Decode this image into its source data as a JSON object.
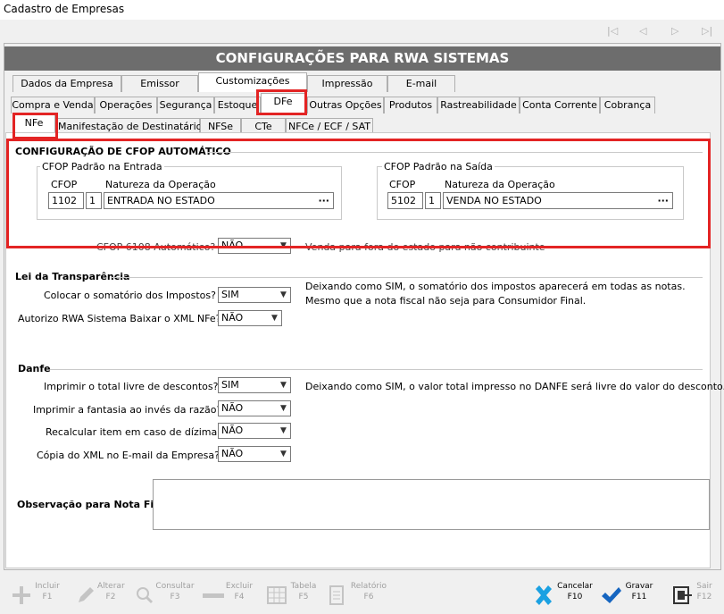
{
  "window": {
    "title": "Cadastro de Empresas"
  },
  "header": {
    "title": "CONFIGURAÇÕES PARA RWA SISTEMAS"
  },
  "tabs_row1": [
    "Dados da Empresa",
    "Emissor",
    "Customizações",
    "Impressão",
    "E-mail"
  ],
  "tabs_row2": [
    "Compra e Venda",
    "Operações",
    "Segurança",
    "Estoque",
    "DFe",
    "Outras Opções",
    "Produtos",
    "Rastreabilidade",
    "Conta Corrente",
    "Cobrança"
  ],
  "tabs_row3": [
    "NFe",
    "Manifestação de Destinatário",
    "NFSe",
    "CTe",
    "NFCe / ECF / SAT"
  ],
  "cfop": {
    "section_title": "CONFIGURAÇÃO DE CFOP AUTOMÁTICO",
    "entrada": {
      "group_label": "CFOP Padrão na Entrada",
      "cfop_label": "CFOP",
      "natureza_label": "Natureza da Operação",
      "cfop_value": "1102",
      "seq_value": "1",
      "natureza_value": "ENTRADA NO ESTADO",
      "btn": "···"
    },
    "saida": {
      "group_label": "CFOP Padrão na Saída",
      "cfop_label": "CFOP",
      "natureza_label": "Natureza da Operação",
      "cfop_value": "5102",
      "seq_value": "1",
      "natureza_value": "VENDA NO ESTADO",
      "btn": "···"
    },
    "auto_label": "CFOP 6108 Automático?",
    "auto_value": "NÃO",
    "auto_note": "Venda para fora do estado para não contribuinte"
  },
  "lei": {
    "title": "Lei da Transparência",
    "somatorio_label": "Colocar o somatório dos Impostos?",
    "somatorio_value": "SIM",
    "note1": "Deixando como SIM, o somatório dos impostos aparecerá em todas as notas.",
    "note2": "Mesmo que a nota fiscal não seja para Consumidor Final.",
    "xml_label": "Autorizo RWA Sistema Baixar o XML NFe?",
    "xml_value": "NÃO"
  },
  "danfe": {
    "title": "Danfe",
    "total_label": "Imprimir o total livre de descontos?",
    "total_value": "SIM",
    "total_note": "Deixando como SIM, o valor total impresso no DANFE será livre do valor do desconto.",
    "fantasia_label": "Imprimir a fantasia ao invés da razão?",
    "fantasia_value": "NÃO",
    "recalc_label": "Recalcular item em caso de dízima?",
    "recalc_value": "NÃO",
    "copia_label": "Cópia do XML no E-mail da Empresa?",
    "copia_value": "NÃO"
  },
  "obs": {
    "label": "Observação para Nota Fiscal"
  },
  "toolbar": {
    "incluir": "Incluir",
    "incluir_key": "F1",
    "alterar": "Alterar",
    "alterar_key": "F2",
    "consultar": "Consultar",
    "consultar_key": "F3",
    "excluir": "Excluir",
    "excluir_key": "F4",
    "tabela": "Tabela",
    "tabela_key": "F5",
    "relatorio": "Relatório",
    "relatorio_key": "F6",
    "cancelar": "Cancelar",
    "cancelar_key": "F10",
    "gravar": "Gravar",
    "gravar_key": "F11",
    "sair": "Sair",
    "sair_key": "F12"
  },
  "colors": {
    "header_bg": "#6d6d6d",
    "highlight_red": "#e32424",
    "cancel_blue": "#1ba1e2",
    "gravar_blue": "#1565c0"
  }
}
